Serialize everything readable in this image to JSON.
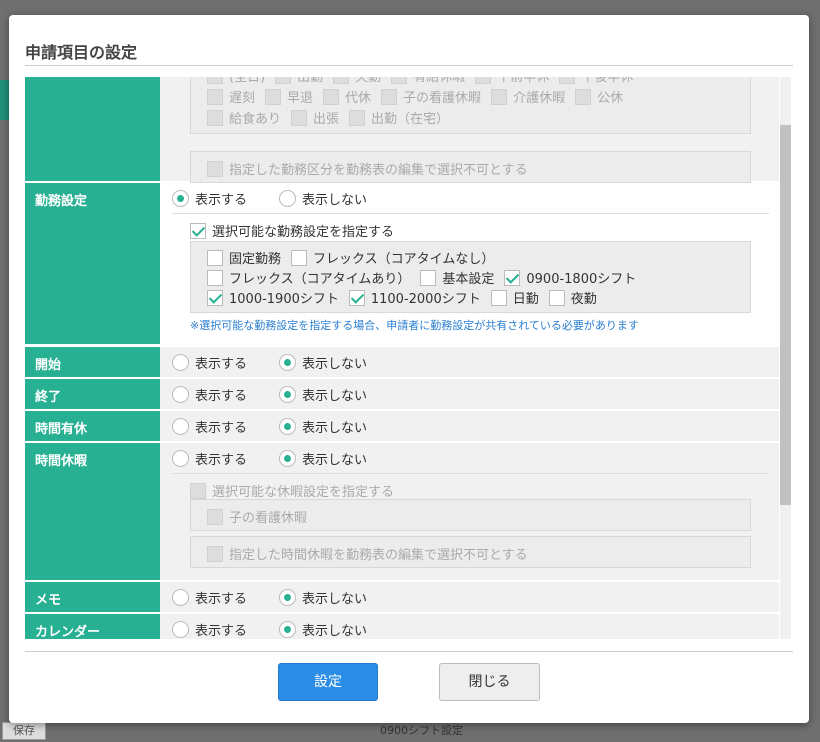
{
  "modal": {
    "title": "申請項目の設定"
  },
  "top_section": {
    "row1": [
      "(全日)",
      "出勤",
      "欠勤",
      "有給休暇",
      "午前半休",
      "午後半休"
    ],
    "row2": [
      "遅刻",
      "早退",
      "代休",
      "子の看護休暇",
      "介護休暇",
      "公休"
    ],
    "row3": [
      "給食あり",
      "出張",
      "出勤（在宅）"
    ],
    "restrict_label": "指定した勤務区分を勤務表の編集で選択不可とする"
  },
  "kinmu": {
    "label": "勤務設定",
    "show": "表示する",
    "hide": "表示しない",
    "specify_label": "選択可能な勤務設定を指定する",
    "options": [
      {
        "label": "固定勤務",
        "checked": false
      },
      {
        "label": "フレックス（コアタイムなし）",
        "checked": false
      },
      {
        "label": "フレックス（コアタイムあり）",
        "checked": false
      },
      {
        "label": "基本設定",
        "checked": false
      },
      {
        "label": "0900-1800シフト",
        "checked": true
      },
      {
        "label": "1000-1900シフト",
        "checked": true
      },
      {
        "label": "1100-2000シフト",
        "checked": true
      },
      {
        "label": "日勤",
        "checked": false
      },
      {
        "label": "夜勤",
        "checked": false
      }
    ],
    "note": "※選択可能な勤務設定を指定する場合、申請者に勤務設定が共有されている必要があります"
  },
  "rows": {
    "start": {
      "label": "開始"
    },
    "end": {
      "label": "終了"
    },
    "hourly_paid": {
      "label": "時間有休"
    },
    "hourly_leave": {
      "label": "時間休暇",
      "specify_label": "選択可能な休暇設定を指定する",
      "option": "子の看護休暇",
      "restrict_label": "指定した時間休暇を勤務表の編集で選択不可とする"
    },
    "memo": {
      "label": "メモ"
    },
    "calendar": {
      "label": "カレンダー"
    }
  },
  "radio": {
    "show": "表示する",
    "hide": "表示しない"
  },
  "buttons": {
    "ok": "設定",
    "close": "閉じる"
  },
  "background": {
    "button": "保存",
    "text": "0900シフト設定"
  },
  "colors": {
    "accent": "#27b092",
    "primary": "#2b8de6"
  }
}
